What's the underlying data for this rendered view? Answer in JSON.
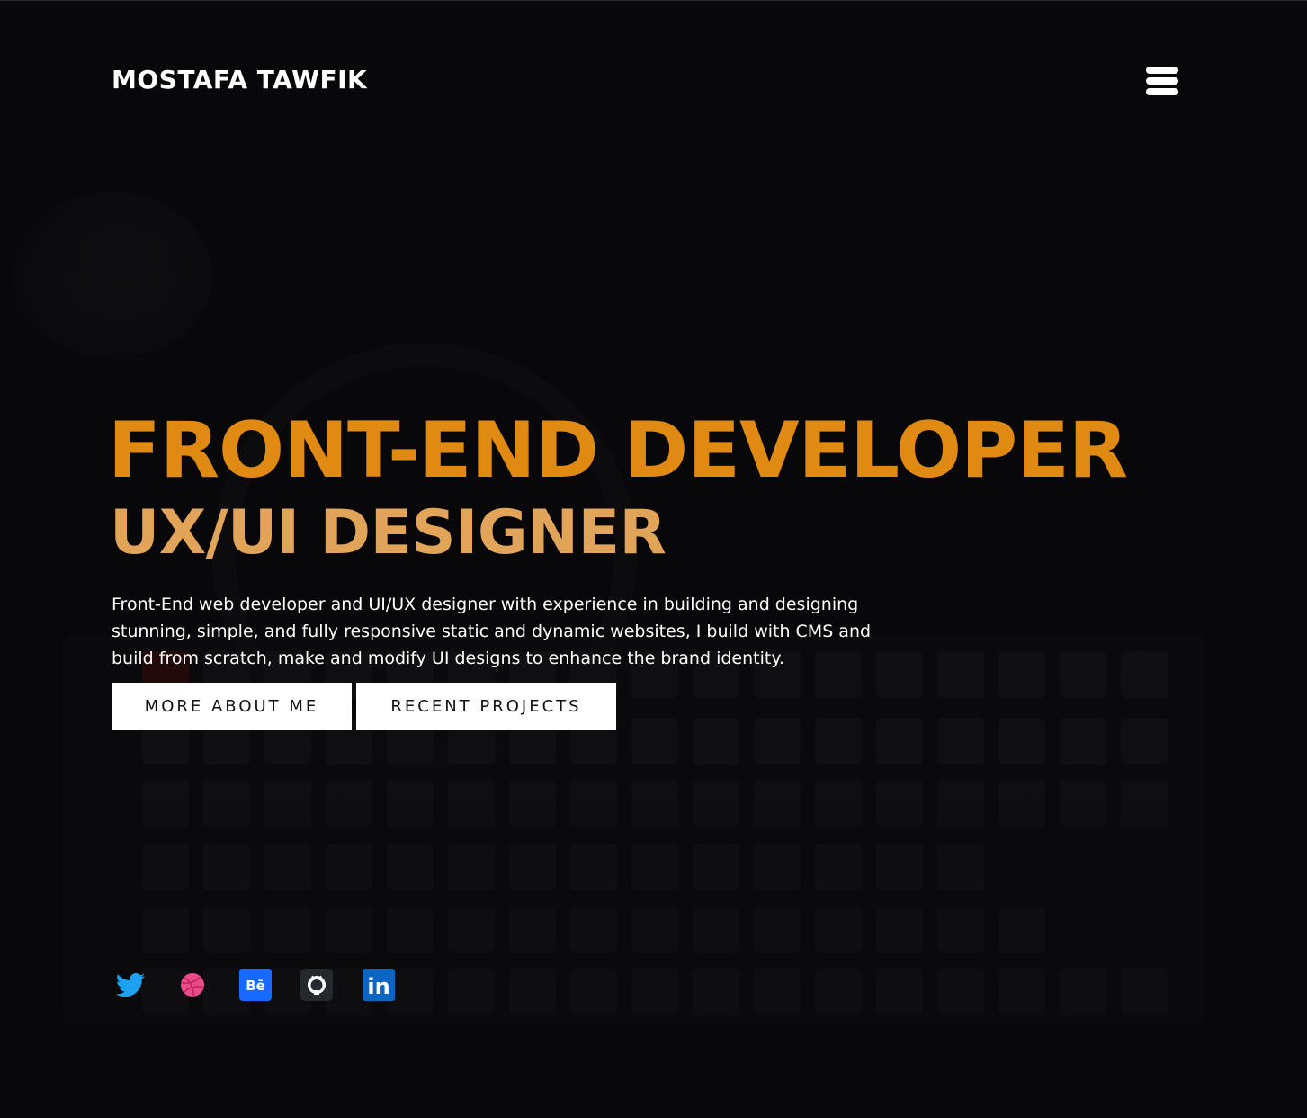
{
  "header": {
    "brand": "MOSTAFA TAWFIK"
  },
  "hero": {
    "title": "FRONT-END DEVELOPER",
    "subtitle": "UX/UI DESIGNER",
    "description": "Front-End web developer and UI/UX designer with experience in building and designing stunning, simple, and fully responsive static and dynamic websites, I build with CMS and build from scratch, make and modify UI designs to enhance the brand identity.",
    "buttons": {
      "about": "MORE ABOUT ME",
      "projects": "RECENT PROJECTS"
    }
  },
  "socials": [
    {
      "icon": "twitter-icon"
    },
    {
      "icon": "dribbble-icon"
    },
    {
      "icon": "behance-icon",
      "glyph": "Bē"
    },
    {
      "icon": "github-icon"
    },
    {
      "icon": "linkedin-icon",
      "glyph": "in"
    }
  ],
  "colors": {
    "title": "#e08a13",
    "subtitle": "#e2a458",
    "background": "#08080a",
    "button_bg": "#ffffff",
    "twitter": "#1da1f2",
    "dribbble": "#ea4c89",
    "behance": "#1769ff",
    "github": "#24292e",
    "linkedin": "#0a66c2"
  }
}
